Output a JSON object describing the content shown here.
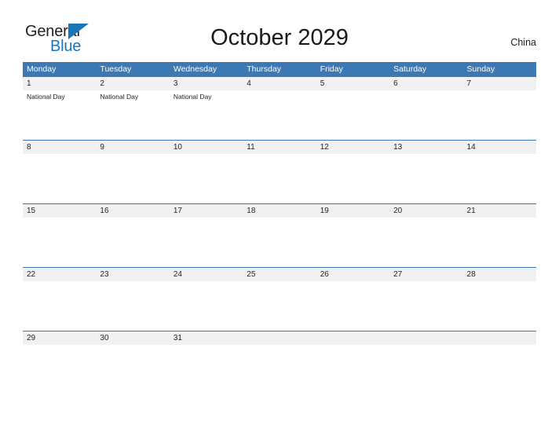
{
  "logo": {
    "word_one": "General",
    "word_two": "Blue",
    "flag_icon": "blue-triangle-flag-icon",
    "color_dark": "#231f20",
    "color_blue": "#1b75bb"
  },
  "header": {
    "title": "October 2029",
    "country": "China"
  },
  "theme": {
    "header_blue": "#3c78b4",
    "date_band_gray": "#f1f1f1",
    "text_dark": "#231f20",
    "page_background": "#ffffff"
  },
  "calendar": {
    "month": "October",
    "year": "2029",
    "weekday_headers": [
      "Monday",
      "Tuesday",
      "Wednesday",
      "Thursday",
      "Friday",
      "Saturday",
      "Sunday"
    ],
    "weeks": [
      {
        "days": [
          {
            "date": "1",
            "events": [
              "National Day"
            ]
          },
          {
            "date": "2",
            "events": [
              "National Day"
            ]
          },
          {
            "date": "3",
            "events": [
              "National Day"
            ]
          },
          {
            "date": "4",
            "events": []
          },
          {
            "date": "5",
            "events": []
          },
          {
            "date": "6",
            "events": []
          },
          {
            "date": "7",
            "events": []
          }
        ]
      },
      {
        "days": [
          {
            "date": "8",
            "events": []
          },
          {
            "date": "9",
            "events": []
          },
          {
            "date": "10",
            "events": []
          },
          {
            "date": "11",
            "events": []
          },
          {
            "date": "12",
            "events": []
          },
          {
            "date": "13",
            "events": []
          },
          {
            "date": "14",
            "events": []
          }
        ]
      },
      {
        "days": [
          {
            "date": "15",
            "events": []
          },
          {
            "date": "16",
            "events": []
          },
          {
            "date": "17",
            "events": []
          },
          {
            "date": "18",
            "events": []
          },
          {
            "date": "19",
            "events": []
          },
          {
            "date": "20",
            "events": []
          },
          {
            "date": "21",
            "events": []
          }
        ]
      },
      {
        "days": [
          {
            "date": "22",
            "events": []
          },
          {
            "date": "23",
            "events": []
          },
          {
            "date": "24",
            "events": []
          },
          {
            "date": "25",
            "events": []
          },
          {
            "date": "26",
            "events": []
          },
          {
            "date": "27",
            "events": []
          },
          {
            "date": "28",
            "events": []
          }
        ]
      },
      {
        "days": [
          {
            "date": "29",
            "events": []
          },
          {
            "date": "30",
            "events": []
          },
          {
            "date": "31",
            "events": []
          },
          {
            "date": "",
            "events": []
          },
          {
            "date": "",
            "events": []
          },
          {
            "date": "",
            "events": []
          },
          {
            "date": "",
            "events": []
          }
        ]
      }
    ]
  }
}
